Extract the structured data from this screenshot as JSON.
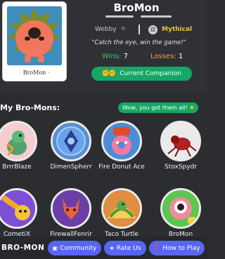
{
  "profile": {
    "card_label": "· BroMon ·",
    "name": "BroMon",
    "owner": "Webby",
    "owner_icon": "spiderweb-icon",
    "rarity": "Mythical",
    "quote": "\"Catch the eye, win the game!\"",
    "wins_label": "Wins:",
    "wins": "7",
    "losses_label": "Losses:",
    "losses": "1",
    "companion_button": "Current Companion"
  },
  "collection": {
    "title": "My Bro-Mons:",
    "toast": "Wow, you got them all!",
    "items": [
      {
        "name": "BrrrBlaze"
      },
      {
        "name": "DimenSpherr"
      },
      {
        "name": "Fire Donut Ace"
      },
      {
        "name": "StoxSpydr"
      },
      {
        "name": "CometiX"
      },
      {
        "name": "FirewallFenrir"
      },
      {
        "name": "Taco Turtle"
      },
      {
        "name": "BroMon"
      }
    ]
  },
  "footer": {
    "logo": "BRO-MON",
    "community": "Community",
    "rate": "Rate Us",
    "how": "How to Play"
  },
  "colors": {
    "background": "#2b2d31",
    "accent_green": "#16a765",
    "button_blue": "#5865f2",
    "mythical_gold": "#f0c431",
    "wins_green": "#45c46a",
    "losses_orange": "#f0a330"
  }
}
